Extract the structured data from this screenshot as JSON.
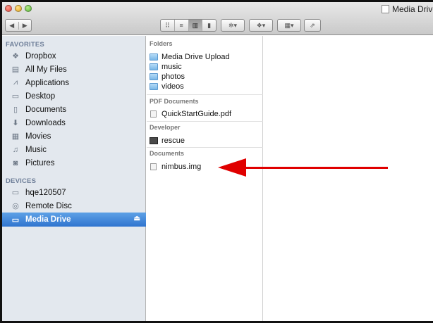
{
  "window": {
    "title": "Media Drive"
  },
  "toolbar": {
    "back_icon": "back-arrow-icon",
    "forward_icon": "forward-arrow-icon",
    "views": [
      "icon-view-icon",
      "list-view-icon",
      "column-view-icon",
      "coverflow-view-icon"
    ],
    "active_view": "column-view-icon"
  },
  "glyphs": {
    "back": "◀",
    "forward": "▶",
    "icon_view": "⠿",
    "list_view": "≡",
    "column_view": "▥",
    "coverflow_view": "▮",
    "action": "✲▾",
    "dropbox": "❖▾",
    "arrange": "▦▾",
    "share": "⇗",
    "eject": "⏏"
  },
  "sidebar": {
    "favorites_header": "FAVORITES",
    "devices_header": "DEVICES",
    "favorites": [
      {
        "label": "Dropbox",
        "icon": "dropbox-icon",
        "glyph": "❖"
      },
      {
        "label": "All My Files",
        "icon": "all-files-icon",
        "glyph": "▤"
      },
      {
        "label": "Applications",
        "icon": "applications-icon",
        "glyph": "⩘"
      },
      {
        "label": "Desktop",
        "icon": "desktop-icon",
        "glyph": "▭"
      },
      {
        "label": "Documents",
        "icon": "documents-icon",
        "glyph": "▯"
      },
      {
        "label": "Downloads",
        "icon": "downloads-icon",
        "glyph": "⬇"
      },
      {
        "label": "Movies",
        "icon": "movies-icon",
        "glyph": "▦"
      },
      {
        "label": "Music",
        "icon": "music-icon",
        "glyph": "♫"
      },
      {
        "label": "Pictures",
        "icon": "pictures-icon",
        "glyph": "◙"
      }
    ],
    "devices": [
      {
        "label": "hqe120507",
        "icon": "laptop-icon",
        "glyph": "▭"
      },
      {
        "label": "Remote Disc",
        "icon": "disc-icon",
        "glyph": "◎"
      },
      {
        "label": "Media Drive",
        "icon": "drive-icon",
        "glyph": "▭",
        "selected": true
      }
    ]
  },
  "column": {
    "sections": [
      {
        "header": "Folders",
        "items": [
          "Media Drive Upload",
          "music",
          "photos",
          "videos"
        ]
      },
      {
        "header": "PDF Documents",
        "items": [
          "QuickStartGuide.pdf"
        ]
      },
      {
        "header": "Developer",
        "items": [
          "rescue"
        ]
      },
      {
        "header": "Documents",
        "items": [
          "nimbus.img"
        ]
      }
    ]
  },
  "colors": {
    "selection": "#3a80d6",
    "sidebar_bg": "#e3e8ee",
    "annotation_arrow": "#e00000"
  }
}
